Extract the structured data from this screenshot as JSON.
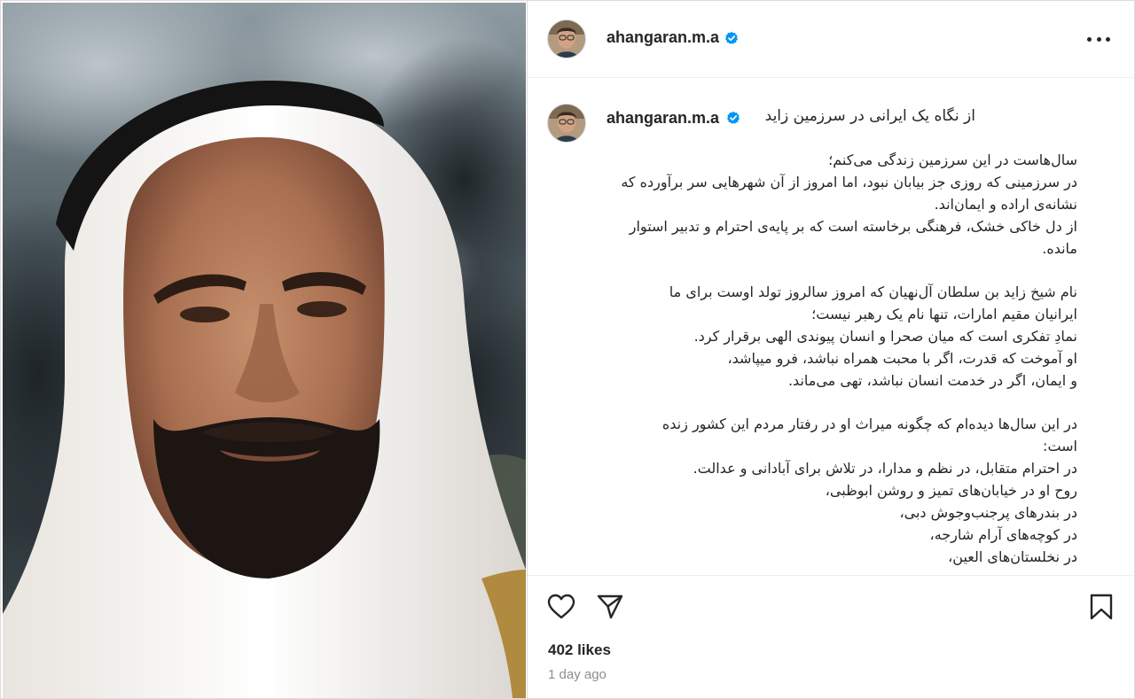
{
  "post": {
    "username": "ahangaran.m.a",
    "verified_icon": "verified-badge-icon",
    "more_icon": "more-options-icon",
    "image_icon": "portrait-photo"
  },
  "caption": {
    "username": "ahangaran.m.a",
    "title": "از نگاه یک ایرانی در سرزمین زاید",
    "paragraphs": [
      [
        "سال‌هاست در این سرزمین زندگی می‌کنم؛",
        "در سرزمینی که روزی جز بیابان نبود، اما امروز از آن شهرهایی سر برآورده که",
        "نشانه‌ی اراده و ایمان‌اند.",
        "از دل خاکی خشک، فرهنگی برخاسته است که بر پایه‌ی احترام و تدبیر استوار",
        "مانده."
      ],
      [
        "نام شیخ زاید بن سلطان آل‌نهیان که امروز سالروز تولد اوست برای ما",
        "ایرانیان مقیم امارات، تنها نام یک رهبر نیست؛",
        "نمادِ تفکری است که میان صحرا و انسان پیوندی الهی برقرار کرد.",
        "او آموخت که قدرت، اگر با محبت همراه نباشد، فرو میپاشد،",
        "و ایمان، اگر در خدمت انسان نباشد، تهی می‌ماند."
      ],
      [
        "در این سال‌ها دیده‌ام که چگونه میراث او در رفتار مردم این کشور زنده",
        "است:",
        "در احترام متقابل، در نظم و مدارا، در تلاش برای آبادانی و عدالت.",
        "روح او در خیابان‌های تمیز و روشن ابوظبی،",
        "در بندرهای پرجنب‌وجوش دبی،",
        "در کوچه‌های آرام شارجه،",
        "در نخلستان‌های العین،"
      ]
    ]
  },
  "actions": {
    "like_icon": "heart-icon",
    "share_icon": "send-icon",
    "save_icon": "bookmark-icon",
    "likes": "402 likes",
    "time_ago": "1 day ago"
  },
  "colors": {
    "text": "#262626",
    "muted": "#8e8e8e",
    "verified": "#0095f6",
    "border": "#dbdbdb"
  }
}
